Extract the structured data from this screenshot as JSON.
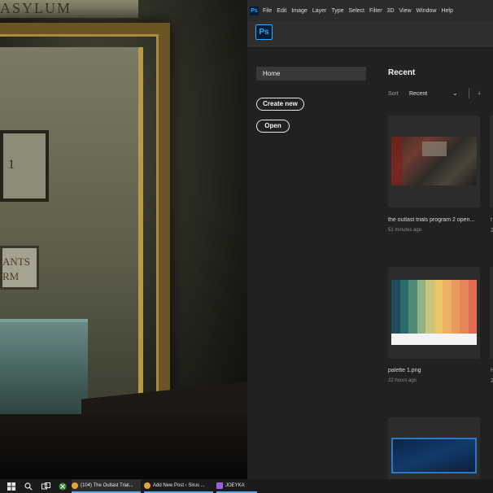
{
  "game": {
    "plaque_text": "1",
    "sign_lines": [
      "ANTS",
      "RM"
    ],
    "top_sign_text": "ASYLUM"
  },
  "photoshop": {
    "mini_logo": "Ps",
    "menu": [
      "File",
      "Edit",
      "Image",
      "Layer",
      "Type",
      "Select",
      "Filter",
      "3D",
      "View",
      "Window",
      "Help"
    ],
    "logo": "Ps",
    "nav_home": "Home",
    "create_new": "Create new",
    "open": "Open",
    "recent_title": "Recent",
    "sort_label": "Sort",
    "sort_value": "Recent",
    "sort_chevron_icon": "chevron-down-icon",
    "sort_direction_icon": "arrow-down-icon",
    "files": [
      {
        "name": "the outlast trials program 2 open...",
        "time": "51 minutes ago"
      },
      {
        "name": "palette 1.png",
        "time": "22 hours ago"
      },
      {
        "name": "",
        "time": ""
      }
    ],
    "peek_texts": [
      "t",
      "2",
      "H",
      "2"
    ],
    "palette_colors": [
      "#1f4d5a",
      "#2d6b6b",
      "#4f8b77",
      "#8fb38a",
      "#c9c77e",
      "#e8c46b",
      "#ecb062",
      "#e99a5e",
      "#e7855a",
      "#e06c57"
    ]
  },
  "taskbar": {
    "items": [
      {
        "label": "(104) The Outlast Trial...",
        "icon_color": "#e8a33a"
      },
      {
        "label": "Add New Post ‹ Sirus ...",
        "icon_color": "#e8a33a"
      },
      {
        "label": "JOEYKA",
        "icon_color": "#9b5de5"
      }
    ]
  }
}
